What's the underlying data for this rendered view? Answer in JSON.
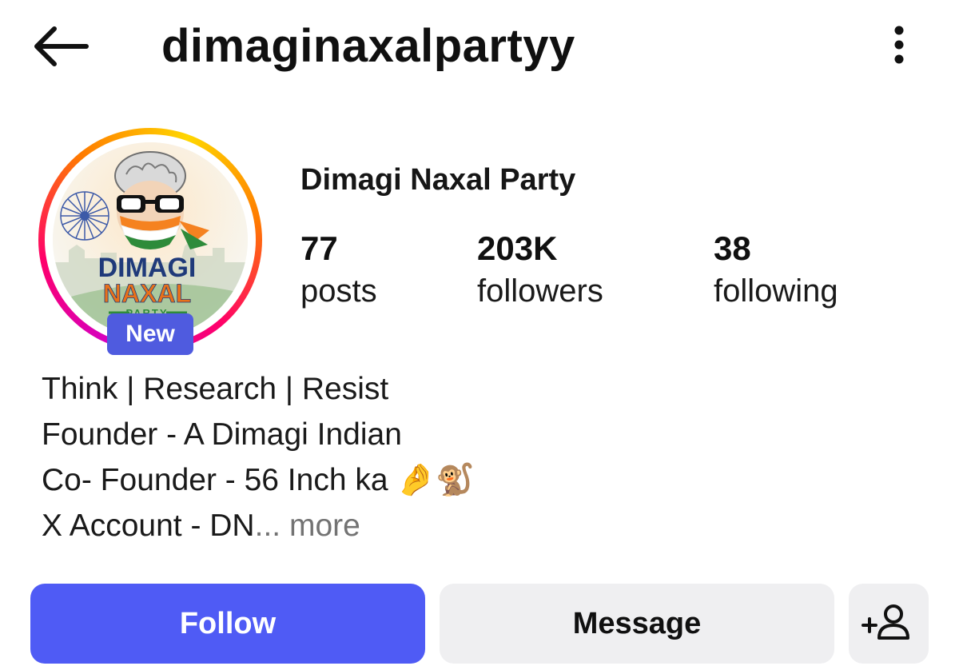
{
  "header": {
    "username": "dimaginaxalpartyy"
  },
  "profile": {
    "display_name": "Dimagi Naxal Party",
    "avatar": {
      "logo_text_line1": "DIMAGI",
      "logo_text_line2": "NAXAL",
      "logo_text_line3": "PARTY",
      "badge": "New"
    },
    "stats": [
      {
        "value": "77",
        "label": "posts"
      },
      {
        "value": "203K",
        "label": "followers"
      },
      {
        "value": "38",
        "label": "following"
      }
    ],
    "bio": {
      "line1": "Think | Research | Resist",
      "line2": "Founder - A Dimagi Indian",
      "line3": "Co- Founder - 56 Inch ka ",
      "line3_emoji": "🤌🐒",
      "line4": "X Account - DN",
      "ellipsis": "... ",
      "more": "more"
    }
  },
  "actions": {
    "follow_label": "Follow",
    "message_label": "Message"
  },
  "colors": {
    "follow_button": "#4f5bf5",
    "badge": "#4f5bdf",
    "secondary_button": "#efeff1"
  },
  "icons": [
    "back-arrow-icon",
    "more-options-icon",
    "add-person-icon"
  ]
}
